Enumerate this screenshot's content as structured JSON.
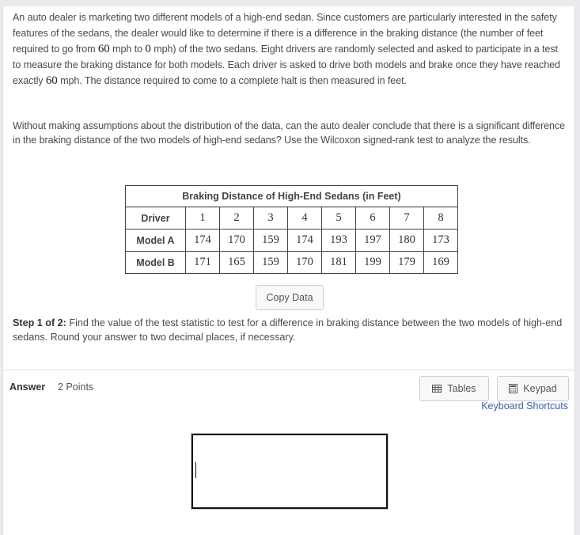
{
  "problem": {
    "p1_a": "An auto dealer is marketing two different models of a high-end sedan. Since customers are particularly interested in the safety features of the sedans, the dealer would like to determine if there is a difference in the braking distance (the number of feet required to go from ",
    "p1_speed1": "60",
    "p1_b": " mph to ",
    "p1_speed2": "0",
    "p1_c": " mph) of the two sedans. Eight drivers are randomly selected and asked to participate in a test to measure the braking distance for both models. Each driver is asked to drive both models and brake once they have reached exactly ",
    "p1_speed3": "60",
    "p1_d": " mph. The distance required to come to a complete halt is then measured in feet.",
    "p2": "Without making assumptions about the distribution of the data, can the auto dealer conclude that there is a significant difference in the braking distance of the two models of high-end sedans? Use the Wilcoxon signed-rank test to analyze the results."
  },
  "table": {
    "title": "Braking Distance of High-End Sedans (in Feet)",
    "rows": [
      {
        "label": "Driver",
        "values": [
          "1",
          "2",
          "3",
          "4",
          "5",
          "6",
          "7",
          "8"
        ]
      },
      {
        "label": "Model A",
        "values": [
          "174",
          "170",
          "159",
          "174",
          "193",
          "197",
          "180",
          "173"
        ]
      },
      {
        "label": "Model B",
        "values": [
          "171",
          "165",
          "159",
          "170",
          "181",
          "199",
          "179",
          "169"
        ]
      }
    ]
  },
  "copy_button": "Copy Data",
  "step": {
    "label": "Step 1 of 2:",
    "text": " Find the value of the test statistic to test for a difference in braking distance between the two models of high-end sedans. Round your answer to two decimal places, if necessary."
  },
  "answer": {
    "label": "Answer",
    "points": "2 Points",
    "value": ""
  },
  "tools": {
    "tables": {
      "label": "Tables",
      "icon": "table-icon"
    },
    "keypad": {
      "label": "Keypad",
      "icon": "calculator-icon"
    },
    "shortcuts": "Keyboard Shortcuts"
  }
}
